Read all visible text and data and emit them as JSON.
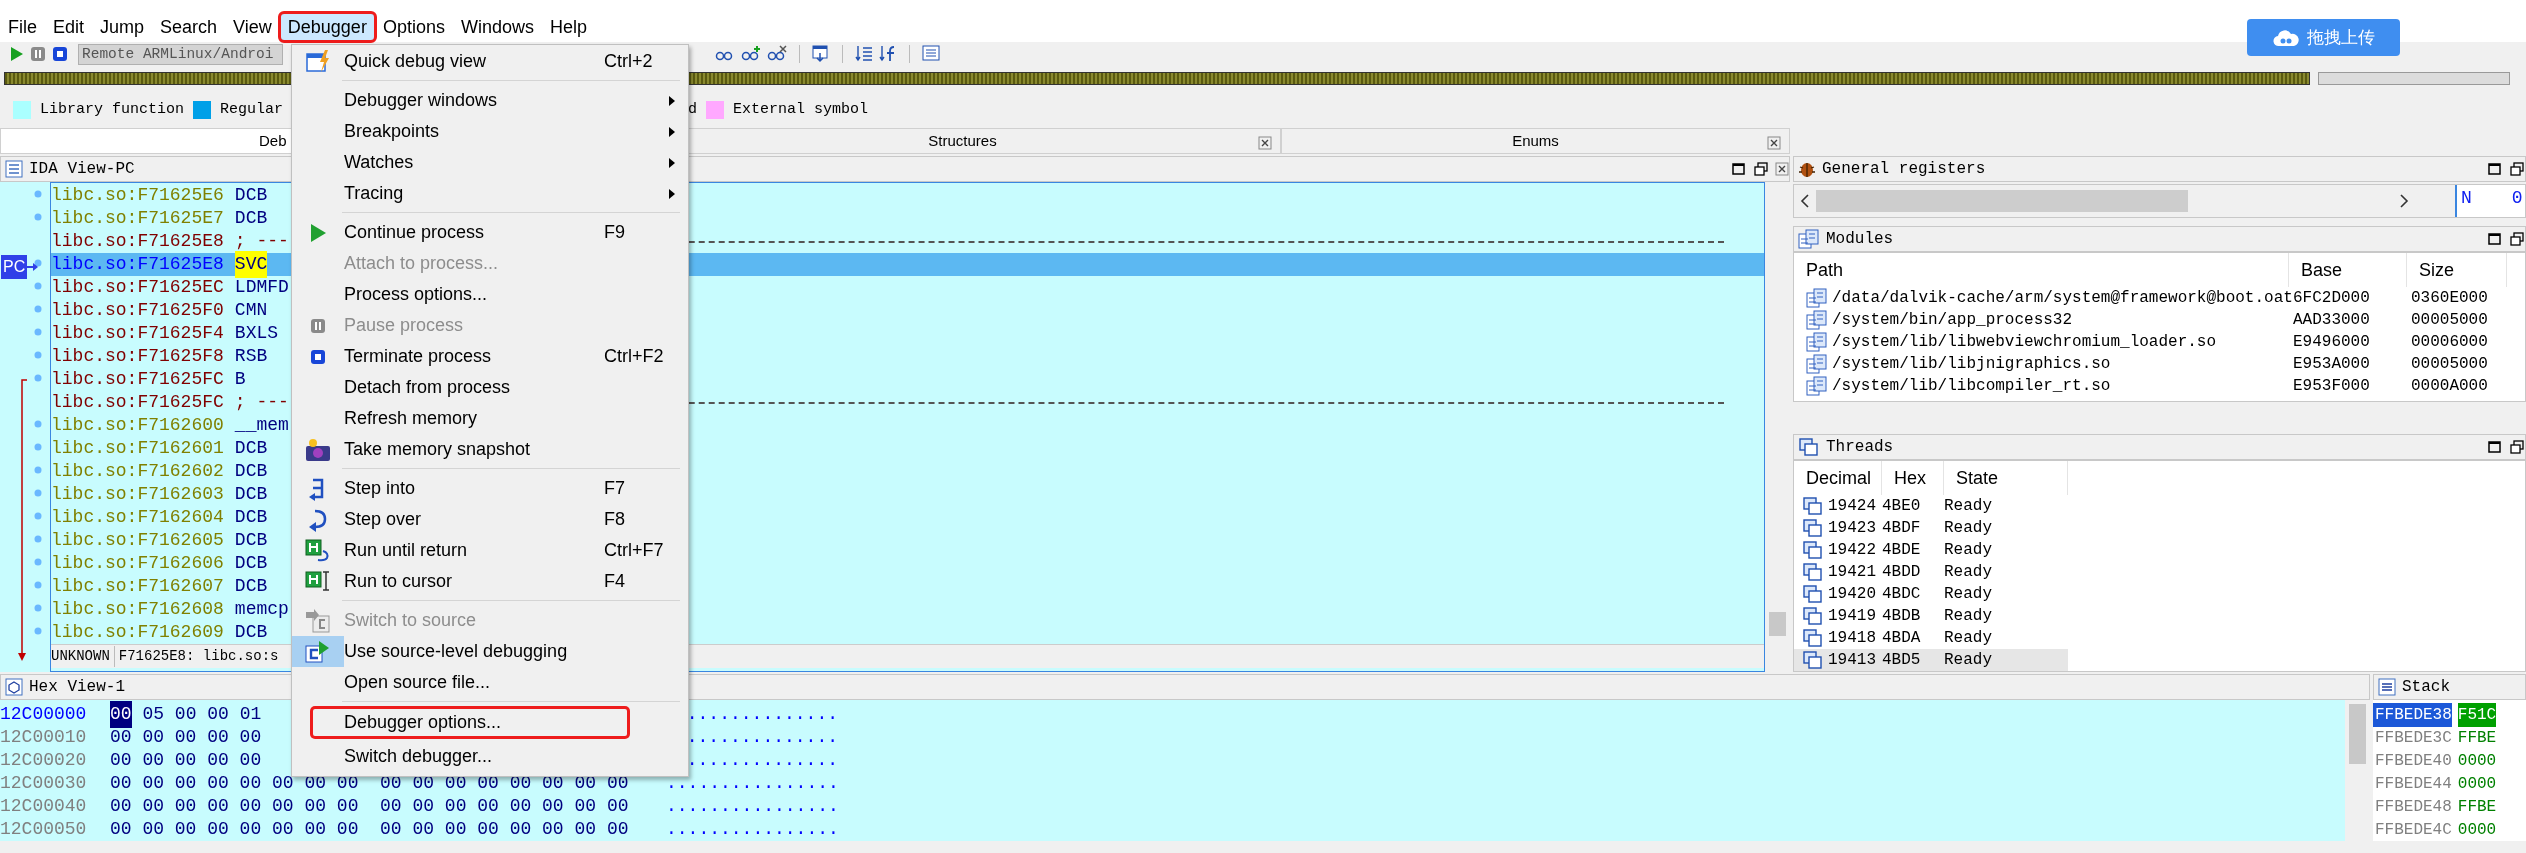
{
  "menu_bar": [
    {
      "label": "File",
      "open": false,
      "annotated": false
    },
    {
      "label": "Edit",
      "open": false,
      "annotated": false
    },
    {
      "label": "Jump",
      "open": false,
      "annotated": false
    },
    {
      "label": "Search",
      "open": false,
      "annotated": false
    },
    {
      "label": "View",
      "open": false,
      "annotated": false
    },
    {
      "label": "Debugger",
      "open": true,
      "annotated": true
    },
    {
      "label": "Options",
      "open": false,
      "annotated": false
    },
    {
      "label": "Windows",
      "open": false,
      "annotated": false
    },
    {
      "label": "Help",
      "open": false,
      "annotated": false
    }
  ],
  "upload_button": {
    "label": "拖拽上传"
  },
  "toolbar": {
    "target": "Remote ARMLinux/Androi"
  },
  "legend": [
    {
      "label": "Library function",
      "color": "#aaffff"
    },
    {
      "label": "Regular",
      "color": "#00a0e8"
    },
    {
      "label": "d"
    },
    {
      "label": "External symbol",
      "color": "#ffa8ff"
    }
  ],
  "tabs": [
    {
      "label": "Deb",
      "selected": true,
      "closable": false
    },
    {
      "label": "Structures",
      "selected": false,
      "closable": true
    },
    {
      "label": "Enums",
      "selected": false,
      "closable": true
    }
  ],
  "ida_view": {
    "title": "IDA View-PC",
    "pc_label": "PC",
    "lines": [
      {
        "kind": "data",
        "address": "libc.so:F71625E6",
        "text": "DCB",
        "selected": false,
        "marked": false
      },
      {
        "kind": "data",
        "address": "libc.so:F71625E7",
        "text": "DCB",
        "selected": false,
        "marked": false
      },
      {
        "kind": "separator",
        "address": "libc.so:F71625E8",
        "text": "; ---",
        "selected": false,
        "marked": false
      },
      {
        "kind": "code",
        "address": "libc.so:F71625E8",
        "text": "SVC",
        "selected": true,
        "marked": true
      },
      {
        "kind": "code",
        "address": "libc.so:F71625EC",
        "text": "LDMFD",
        "selected": false,
        "marked": false
      },
      {
        "kind": "code",
        "address": "libc.so:F71625F0",
        "text": "CMN",
        "selected": false,
        "marked": false
      },
      {
        "kind": "code",
        "address": "libc.so:F71625F4",
        "text": "BXLS",
        "selected": false,
        "marked": false
      },
      {
        "kind": "code",
        "address": "libc.so:F71625F8",
        "text": "RSB",
        "selected": false,
        "marked": false
      },
      {
        "kind": "code",
        "address": "libc.so:F71625FC",
        "text": "B",
        "selected": false,
        "marked": false
      },
      {
        "kind": "separator",
        "address": "libc.so:F71625FC",
        "text": "; ---",
        "selected": false,
        "marked": false
      },
      {
        "kind": "data",
        "address": "libc.so:F7162600",
        "text": "__mem",
        "selected": false,
        "marked": false
      },
      {
        "kind": "data",
        "address": "libc.so:F7162601",
        "text": "DCB",
        "selected": false,
        "marked": false
      },
      {
        "kind": "data",
        "address": "libc.so:F7162602",
        "text": "DCB",
        "selected": false,
        "marked": false
      },
      {
        "kind": "data",
        "address": "libc.so:F7162603",
        "text": "DCB",
        "selected": false,
        "marked": false
      },
      {
        "kind": "data",
        "address": "libc.so:F7162604",
        "text": "DCB",
        "selected": false,
        "marked": false
      },
      {
        "kind": "data",
        "address": "libc.so:F7162605",
        "text": "DCB",
        "selected": false,
        "marked": false
      },
      {
        "kind": "data",
        "address": "libc.so:F7162606",
        "text": "DCB",
        "selected": false,
        "marked": false
      },
      {
        "kind": "data",
        "address": "libc.so:F7162607",
        "text": "DCB",
        "selected": false,
        "marked": false
      },
      {
        "kind": "data",
        "address": "libc.so:F7162608",
        "text": "memcp",
        "selected": false,
        "marked": false
      },
      {
        "kind": "data",
        "address": "libc.so:F7162609",
        "text": "DCB",
        "selected": false,
        "marked": false
      }
    ],
    "status": [
      "UNKNOWN",
      "F71625E8: libc.so:s"
    ]
  },
  "debugger_menu": {
    "groups": [
      [
        {
          "label": "Quick debug view",
          "shortcut": "Ctrl+2",
          "disabled": false,
          "submenu": false,
          "checked": false,
          "annotated": false
        }
      ],
      [
        {
          "label": "Debugger windows",
          "disabled": false,
          "submenu": true,
          "checked": false,
          "annotated": false
        },
        {
          "label": "Breakpoints",
          "disabled": false,
          "submenu": true,
          "checked": false,
          "annotated": false
        },
        {
          "label": "Watches",
          "disabled": false,
          "submenu": true,
          "checked": false,
          "annotated": false
        },
        {
          "label": "Tracing",
          "disabled": false,
          "submenu": true,
          "checked": false,
          "annotated": false
        }
      ],
      [
        {
          "label": "Continue process",
          "shortcut": "F9",
          "disabled": false,
          "submenu": false,
          "checked": false,
          "annotated": false
        },
        {
          "label": "Attach to process...",
          "disabled": true,
          "submenu": false,
          "checked": false,
          "annotated": false
        },
        {
          "label": "Process options...",
          "disabled": false,
          "submenu": false,
          "checked": false,
          "annotated": false
        },
        {
          "label": "Pause process",
          "disabled": true,
          "submenu": false,
          "checked": false,
          "annotated": false
        },
        {
          "label": "Terminate process",
          "shortcut": "Ctrl+F2",
          "disabled": false,
          "submenu": false,
          "checked": false,
          "annotated": false
        },
        {
          "label": "Detach from process",
          "disabled": false,
          "submenu": false,
          "checked": false,
          "annotated": false
        },
        {
          "label": "Refresh memory",
          "disabled": false,
          "submenu": false,
          "checked": false,
          "annotated": false
        },
        {
          "label": "Take memory snapshot",
          "disabled": false,
          "submenu": false,
          "checked": false,
          "annotated": false
        }
      ],
      [
        {
          "label": "Step into",
          "shortcut": "F7",
          "disabled": false,
          "submenu": false,
          "checked": false,
          "annotated": false
        },
        {
          "label": "Step over",
          "shortcut": "F8",
          "disabled": false,
          "submenu": false,
          "checked": false,
          "annotated": false
        },
        {
          "label": "Run until return",
          "shortcut": "Ctrl+F7",
          "disabled": false,
          "submenu": false,
          "checked": false,
          "annotated": false
        },
        {
          "label": "Run to cursor",
          "shortcut": "F4",
          "disabled": false,
          "submenu": false,
          "checked": false,
          "annotated": false
        }
      ],
      [
        {
          "label": "Switch to source",
          "disabled": true,
          "submenu": false,
          "checked": false,
          "annotated": false
        },
        {
          "label": "Use source-level debugging",
          "disabled": false,
          "submenu": false,
          "checked": true,
          "annotated": false
        },
        {
          "label": "Open source file...",
          "disabled": false,
          "submenu": false,
          "checked": false,
          "annotated": false
        }
      ],
      [
        {
          "label": "Debugger options...",
          "disabled": false,
          "submenu": false,
          "checked": false,
          "annotated": true
        },
        {
          "label": "Switch debugger...",
          "disabled": false,
          "submenu": false,
          "checked": false,
          "annotated": false
        }
      ]
    ]
  },
  "registers": {
    "title": "General registers",
    "flag": {
      "label": "N",
      "value": "0"
    }
  },
  "modules": {
    "title": "Modules",
    "columns": [
      "Path",
      "Base",
      "Size"
    ],
    "rows": [
      [
        "/data/dalvik-cache/arm/system@framework@boot.oat",
        "6FC2D000",
        "0360E000"
      ],
      [
        "/system/bin/app_process32",
        "AAD33000",
        "00005000"
      ],
      [
        "/system/lib/libwebviewchromium_loader.so",
        "E9496000",
        "00006000"
      ],
      [
        "/system/lib/libjnigraphics.so",
        "E953A000",
        "00005000"
      ],
      [
        "/system/lib/libcompiler_rt.so",
        "E953F000",
        "0000A000"
      ]
    ]
  },
  "threads": {
    "title": "Threads",
    "columns": [
      "Decimal",
      "Hex",
      "State"
    ],
    "rows": [
      {
        "cells": [
          "19424",
          "4BE0",
          "Ready"
        ],
        "selected": false
      },
      {
        "cells": [
          "19423",
          "4BDF",
          "Ready"
        ],
        "selected": false
      },
      {
        "cells": [
          "19422",
          "4BDE",
          "Ready"
        ],
        "selected": false
      },
      {
        "cells": [
          "19421",
          "4BDD",
          "Ready"
        ],
        "selected": false
      },
      {
        "cells": [
          "19420",
          "4BDC",
          "Ready"
        ],
        "selected": false
      },
      {
        "cells": [
          "19419",
          "4BDB",
          "Ready"
        ],
        "selected": false
      },
      {
        "cells": [
          "19418",
          "4BDA",
          "Ready"
        ],
        "selected": false
      },
      {
        "cells": [
          "19413",
          "4BD5",
          "Ready"
        ],
        "selected": true
      }
    ]
  },
  "hex_view": {
    "title": "Hex View-1",
    "rows": [
      {
        "address": "12C00000",
        "cursor_byte": "00",
        "bytes": "05 00 00 01",
        "ascii": "..............",
        "selected": true
      },
      {
        "address": "12C00010",
        "bytes": "00 00 00 00 00",
        "ascii": "..............",
        "selected": false
      },
      {
        "address": "12C00020",
        "bytes": "00 00 00 00 00",
        "ascii": "..............",
        "selected": false
      },
      {
        "address": "12C00030",
        "bytes": "00 00 00 00 00 00 00 00  00 00 00 00 00 00 00 00",
        "ascii": "................",
        "selected": false
      },
      {
        "address": "12C00040",
        "bytes": "00 00 00 00 00 00 00 00  00 00 00 00 00 00 00 00",
        "ascii": "................",
        "selected": false
      },
      {
        "address": "12C00050",
        "bytes": "00 00 00 00 00 00 00 00  00 00 00 00 00 00 00 00",
        "ascii": "................",
        "selected": false
      }
    ]
  },
  "stack": {
    "title": "Stack",
    "rows": [
      {
        "address": "FFBEDE38",
        "value": "F51C",
        "selected": true
      },
      {
        "address": "FFBEDE3C",
        "value": "FFBE",
        "selected": false
      },
      {
        "address": "FFBEDE40",
        "value": "0000",
        "selected": false
      },
      {
        "address": "FFBEDE44",
        "value": "0000",
        "selected": false
      },
      {
        "address": "FFBEDE48",
        "value": "FFBE",
        "selected": false
      },
      {
        "address": "FFBEDE4C",
        "value": "0000",
        "selected": false
      }
    ]
  }
}
